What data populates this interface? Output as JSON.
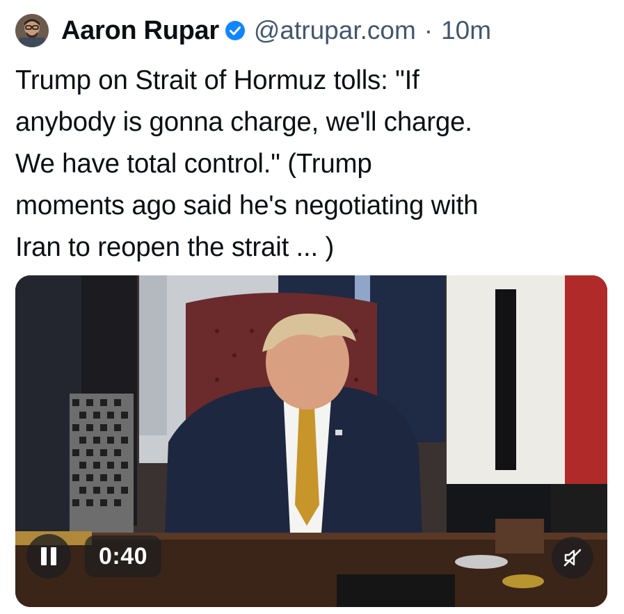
{
  "post": {
    "author": {
      "name": "Aaron Rupar",
      "handle": "@atrupar.com",
      "verified": true
    },
    "separator": "·",
    "timestamp": "10m",
    "text_lines": [
      "Trump on Strait of Hormuz tolls: \"If",
      "anybody is gonna charge, we'll charge.",
      "We have total control.\" (Trump",
      "moments ago said he's negotiating with",
      "Iran to reopen the strait ... )"
    ]
  },
  "video": {
    "elapsed_time": "0:40",
    "state": "playing",
    "muted": true,
    "controls": {
      "pause_icon": "pause-icon",
      "mute_icon": "speaker-muted-icon"
    }
  },
  "colors": {
    "text": "#0b0f14",
    "secondary_text": "#42576c",
    "verified_badge": "#1185fe",
    "control_bg": "#1e1e20"
  }
}
